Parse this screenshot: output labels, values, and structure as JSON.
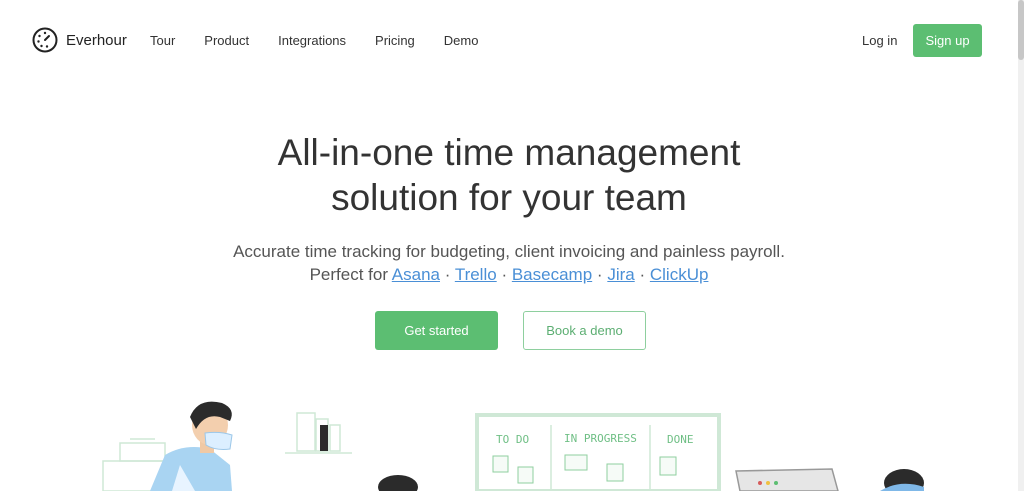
{
  "header": {
    "brand": "Everhour",
    "nav": [
      "Tour",
      "Product",
      "Integrations",
      "Pricing",
      "Demo"
    ],
    "login_label": "Log in",
    "signup_label": "Sign up"
  },
  "hero": {
    "title_line1": "All-in-one time management",
    "title_line2": "solution for your team",
    "subtitle_line1": "Accurate time tracking for budgeting, client invoicing and painless payroll.",
    "perfect_for_label": "Perfect for",
    "integrations": [
      "Asana",
      "Trello",
      "Basecamp",
      "Jira",
      "ClickUp"
    ],
    "separator": "·",
    "cta_primary": "Get started",
    "cta_secondary": "Book a demo"
  },
  "board": {
    "columns": [
      "TO DO",
      "IN PROGRESS",
      "DONE"
    ]
  },
  "colors": {
    "accent": "#5cbe72",
    "link": "#4a8fd6",
    "text": "#333333"
  }
}
